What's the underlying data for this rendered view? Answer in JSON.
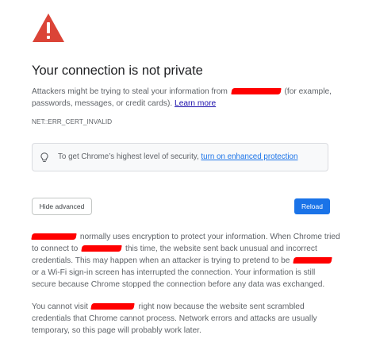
{
  "interstitial": {
    "title": "Your connection is not private",
    "explanation_before": "Attackers might be trying to steal your information from ",
    "explanation_after": " (for example, passwords, messages, or credit cards). ",
    "learn_more": "Learn more",
    "error_code": "NET::ERR_CERT_INVALID"
  },
  "enhanced_protection": {
    "text": "To get Chrome’s highest level of security, ",
    "link": "turn on enhanced protection"
  },
  "buttons": {
    "hide_advanced": "Hide advanced",
    "reload": "Reload"
  },
  "details": {
    "paragraph1_part1": " normally uses encryption to protect your information. When Chrome tried to connect to ",
    "paragraph1_part2": " this time, the website sent back unusual and incorrect credentials. This may happen when an attacker is trying to pretend to be ",
    "paragraph1_part3": " or a Wi-Fi sign-in screen has interrupted the connection. Your information is still secure because Chrome stopped the connection before any data was exchanged.",
    "paragraph2_part1": "You cannot visit ",
    "paragraph2_part2": " right now because the website sent scrambled credentials that Chrome cannot process. Network errors and attacks are usually temporary, so this page will probably work later."
  },
  "colors": {
    "warning_red": "#db4437",
    "link_blue": "#1a73e8",
    "reload_blue": "#1a73e8",
    "redaction_red": "#ff0000",
    "body_text": "#5f6368",
    "title_text": "#202124"
  },
  "icons": {
    "warning": "warning-triangle-icon",
    "lightbulb": "lightbulb-icon"
  }
}
